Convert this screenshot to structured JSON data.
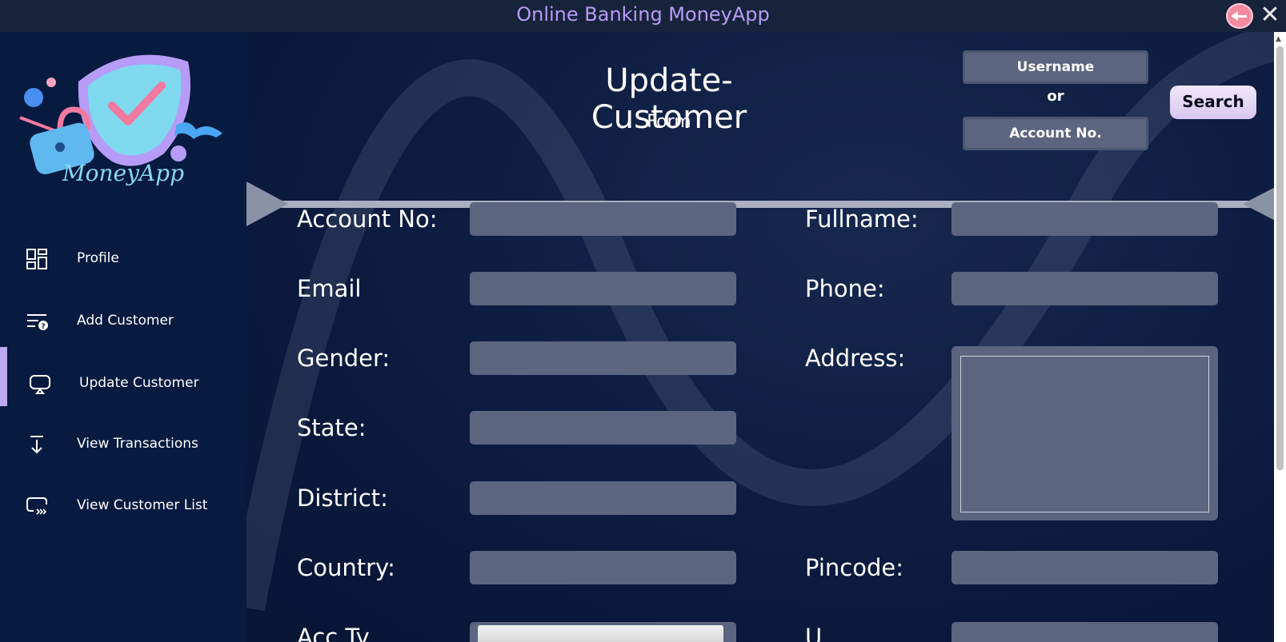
{
  "window": {
    "title": "Online Banking MoneyApp"
  },
  "brand": {
    "name": "MoneyApp"
  },
  "sidebar": {
    "items": [
      {
        "label": "Profile",
        "icon": "dashboard-icon"
      },
      {
        "label": "Add Customer",
        "icon": "add-customer-icon"
      },
      {
        "label": "Update Customer",
        "icon": "update-customer-icon",
        "active": true
      },
      {
        "label": "View Transactions",
        "icon": "download-arrow-icon"
      },
      {
        "label": "View Customer List",
        "icon": "customer-list-icon"
      }
    ]
  },
  "header": {
    "title": "Update-Customer",
    "subtitle": "Form",
    "search": {
      "username_label": "Username",
      "or_label": "or",
      "account_label": "Account No.",
      "button_label": "Search"
    }
  },
  "form": {
    "account_no_label": "Account No:",
    "fullname_label": "Fullname:",
    "email_label": "Email",
    "phone_label": "Phone:",
    "gender_label": "Gender:",
    "address_label": "Address:",
    "state_label": "State:",
    "district_label": "District:",
    "country_label": "Country:",
    "pincode_label": "Pincode:",
    "acc_type_label": "Acc Ty",
    "username_label": "U"
  },
  "colors": {
    "titlebar": "#17233a",
    "title_text": "#b79cf7",
    "sidebar_bg": "#071a3f",
    "main_bg": "#0c1a3d",
    "input_bg": "#5b6580",
    "active_indicator": "#bda9f2",
    "search_button": "#e4d8f5"
  }
}
